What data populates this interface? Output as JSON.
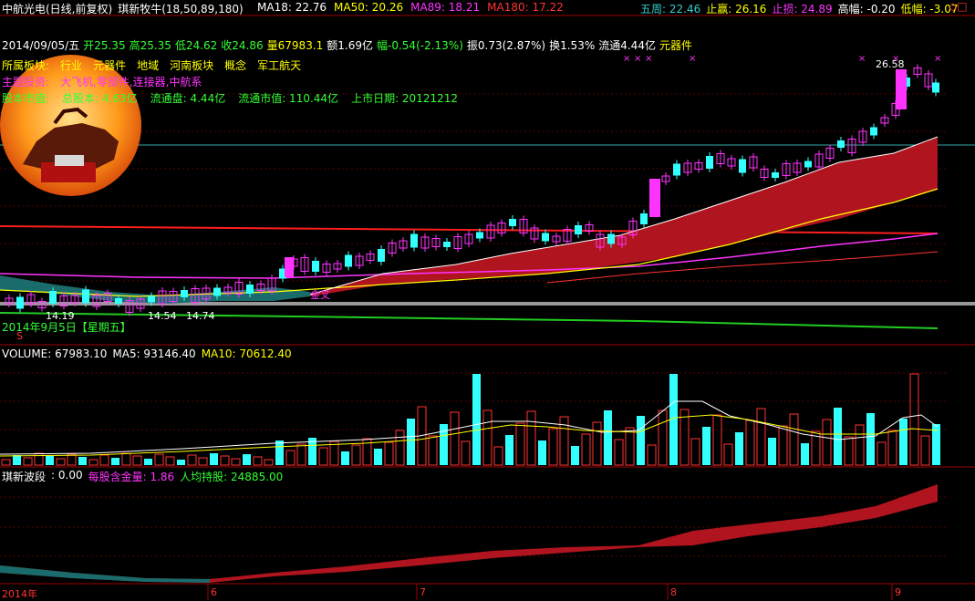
{
  "header": {
    "stock_name": "中航光电(日线,前复权)",
    "indicator_name": "琪新牧牛(18,50,89,180)",
    "ma_items": [
      {
        "label": "MA18: 22.76",
        "color": "#ffffff"
      },
      {
        "label": "MA50: 20.26",
        "color": "#ffff00"
      },
      {
        "label": "MA89: 18.21",
        "color": "#ff33ff"
      },
      {
        "label": "MA180: 17.22",
        "color": "#ff3333"
      }
    ],
    "right_items": [
      {
        "label": "五周: 22.46",
        "color": "#33cccc"
      },
      {
        "label": "止赢: 26.16",
        "color": "#ffff00"
      },
      {
        "label": "止损: 24.89",
        "color": "#ff33ff"
      },
      {
        "label": "高幅: -0.20",
        "color": "#ffffff"
      },
      {
        "label": "低幅: -3.07",
        "color": "#ffff00"
      }
    ],
    "corner_glyphs": "◇□"
  },
  "info": {
    "date": "2014/09/05/五",
    "open": "开25.35",
    "high": "高25.35",
    "low": "低24.62",
    "close": "收24.86",
    "volume": "量67983.1",
    "amount": "额1.69亿",
    "change": "幅-0.54(-2.13%)",
    "amplitude": "振0.73(2.87%)",
    "turnover": "换1.53%",
    "float": "流通4.44亿",
    "sector": "元器件"
  },
  "overlay": {
    "board_label": "所属板块:",
    "industry_label": "行业",
    "industry_value": "元器件",
    "region_label": "地域",
    "region_value": "河南板块",
    "concept_label": "概念",
    "concept_value": "军工航天",
    "theme_label": "主题投资:",
    "theme_value": "大飞机,零部件,连接器,中航系",
    "cap_label": "股本市值:",
    "total_shares": "总股本: 4.63亿",
    "float_shares": "流通盘: 4.44亿",
    "float_cap": "流通市值: 110.44亿",
    "list_date": "上市日期: 20121212"
  },
  "price_labels": {
    "peak": "26.58",
    "low1": "14.19",
    "low2": "14.54",
    "low3": "14.74",
    "cross_tag": "金叉",
    "date_overlay": "2014年9月5日【星期五】",
    "red_tag": "S"
  },
  "volume_panel": {
    "vol": "VOLUME: 67983.10",
    "ma5": "MA5: 93146.40",
    "ma10": "MA10: 70612.40"
  },
  "wave_panel": {
    "name": "琪新波段",
    "val": ": 0.00",
    "gold_label": "每股含金量: 1.86",
    "holding_label": "人均持股: 24885.00"
  },
  "axis": {
    "months": [
      "2014年",
      "6",
      "7",
      "8",
      "9"
    ]
  },
  "colors": {
    "up": "#ff33ff",
    "down": "#33ffff",
    "band": "#b0141e",
    "band_green": "#1a6b6b"
  }
}
